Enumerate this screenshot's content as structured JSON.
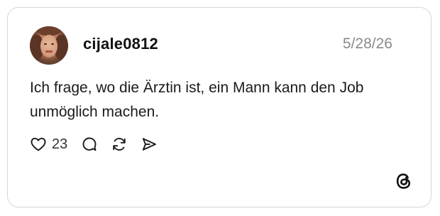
{
  "post": {
    "username": "cijale0812",
    "date": "5/28/26",
    "text": "Ich frage, wo die Ärztin ist, ein Mann kann den Job unmöglich machen.",
    "like_count": "23"
  },
  "icons": {
    "like": "heart-icon",
    "reply": "comment-icon",
    "repost": "repost-icon",
    "share": "share-icon",
    "brand": "threads-logo-icon"
  }
}
